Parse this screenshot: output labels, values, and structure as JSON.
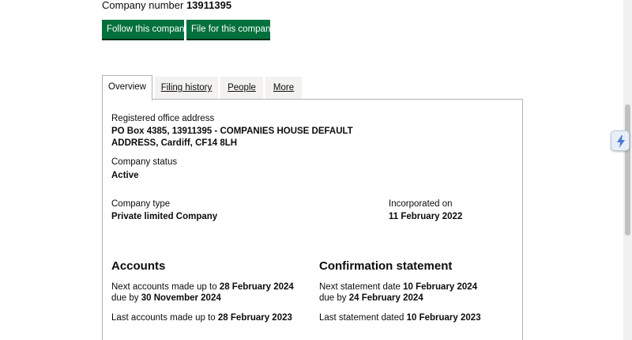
{
  "header": {
    "company_number_label": "Company number",
    "company_number": "13911395"
  },
  "actions": {
    "follow_label": "Follow this company",
    "file_label": "File for this company"
  },
  "tabs": [
    {
      "label": "Overview"
    },
    {
      "label": "Filing history"
    },
    {
      "label": "People"
    },
    {
      "label": "More"
    }
  ],
  "overview": {
    "address_label": "Registered office address",
    "address_line1": "PO Box 4385, 13911395 - COMPANIES HOUSE DEFAULT",
    "address_line2": "ADDRESS, Cardiff, CF14 8LH",
    "status_label": "Company status",
    "status_value": "Active",
    "type_label": "Company type",
    "type_value": "Private limited Company",
    "incorporated_label": "Incorporated on",
    "incorporated_value": "11 February 2022"
  },
  "accounts": {
    "heading": "Accounts",
    "next_made_up_prefix": "Next accounts made up to",
    "next_made_up_date": "28 February 2024",
    "due_by_prefix": "due by",
    "due_by_date": "30 November 2024",
    "last_made_up_prefix": "Last accounts made up to",
    "last_made_up_date": "28 February 2023"
  },
  "confirmation": {
    "heading": "Confirmation statement",
    "next_date_prefix": "Next statement date",
    "next_date": "10 February 2024",
    "due_by_prefix": "due by",
    "due_by_date": "24 February 2024",
    "last_prefix": "Last statement dated",
    "last_date": "10 February 2023"
  },
  "extension": {
    "icon": "lightning-icon",
    "accent": "#4a7bd0"
  },
  "colors": {
    "button_green": "#00703c",
    "tab_bg": "#f3f2f1",
    "border": "#b1b4b6"
  }
}
